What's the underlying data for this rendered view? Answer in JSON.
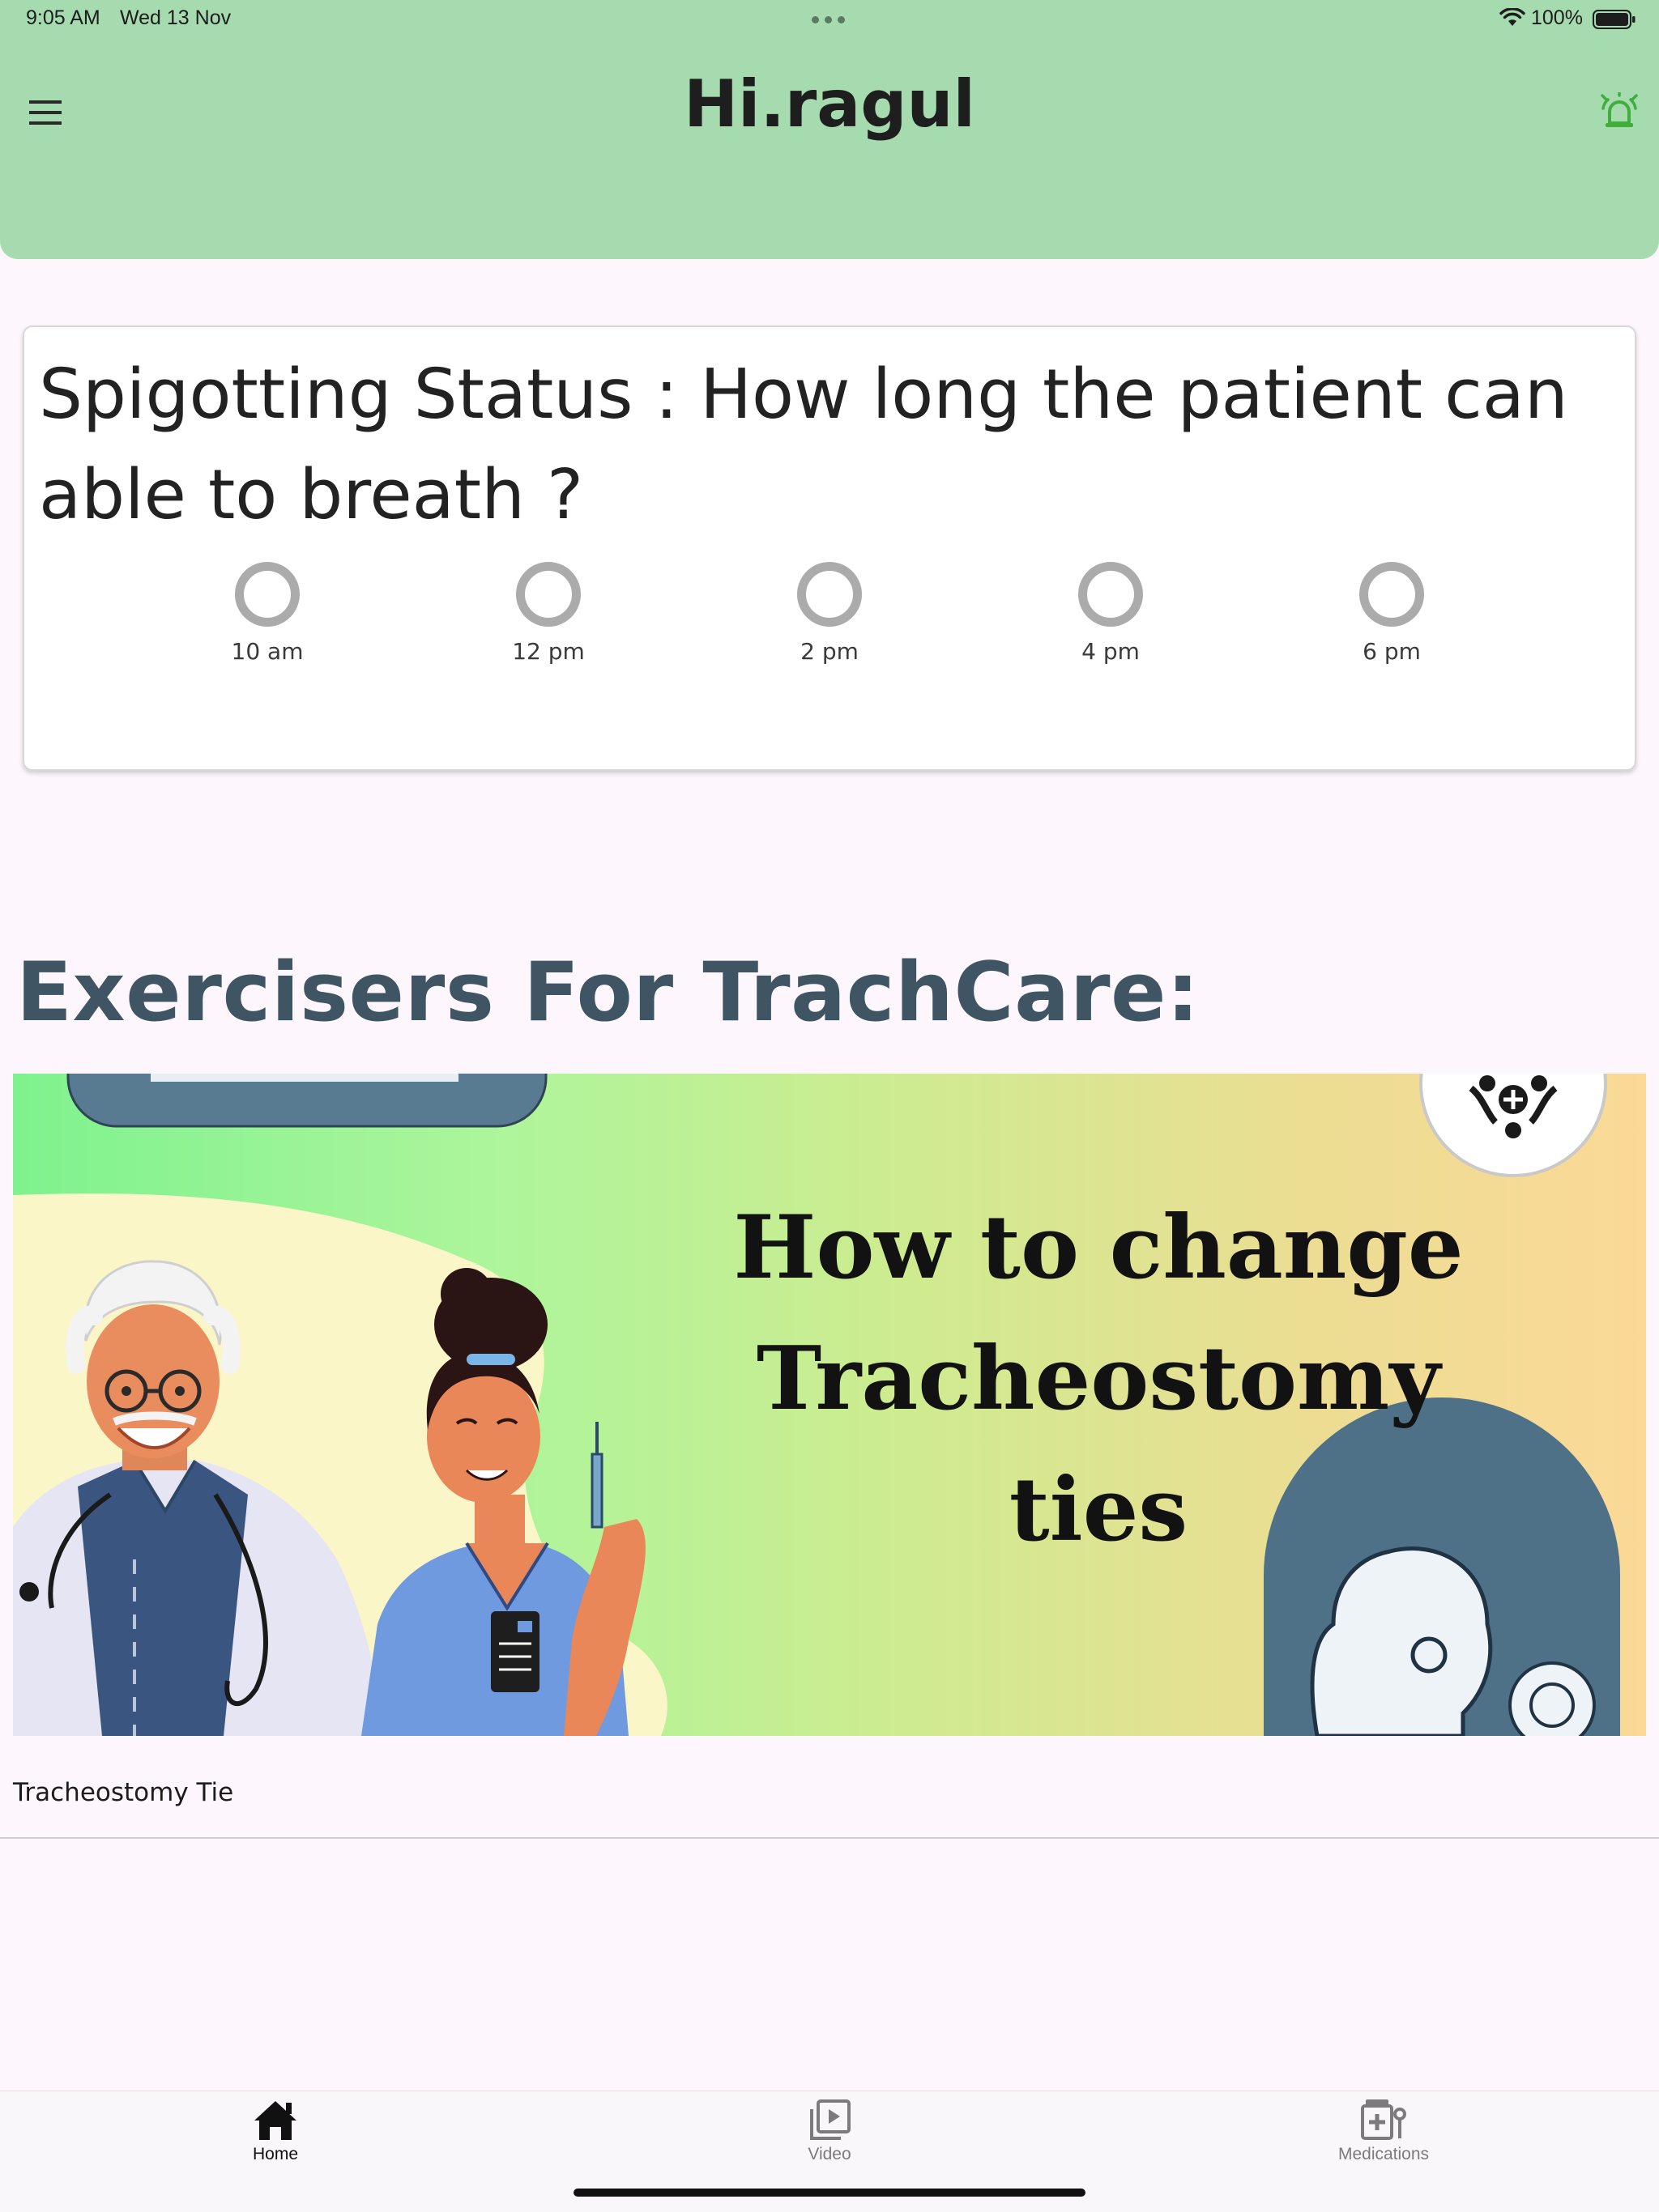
{
  "status_bar": {
    "time": "9:05 AM",
    "date": "Wed 13 Nov",
    "battery": "100%"
  },
  "header": {
    "title": "Hi.ragul",
    "menu_icon": "hamburger-menu-icon",
    "alarm_icon": "alarm-bell-icon",
    "background_color": "#a6dbaf",
    "alarm_color": "#3fae3a"
  },
  "spigot_card": {
    "question": "Spigotting Status : How long the patient can able to breath ?",
    "options": [
      "10 am",
      "12 pm",
      "2 pm",
      "4 pm",
      "6 pm"
    ]
  },
  "exercises": {
    "title": "Exercisers For TrachCare:",
    "title_color": "#3f5563",
    "video": {
      "thumbnail_heading_line1": "How to change",
      "thumbnail_heading_line2": "Tracheostomy ties",
      "caption": "Tracheostomy Tie"
    }
  },
  "tabbar": {
    "tabs": [
      {
        "label": "Home",
        "icon": "home-icon",
        "active": true
      },
      {
        "label": "Video",
        "icon": "video-library-icon",
        "active": false
      },
      {
        "label": "Medications",
        "icon": "medications-icon",
        "active": false
      }
    ]
  }
}
